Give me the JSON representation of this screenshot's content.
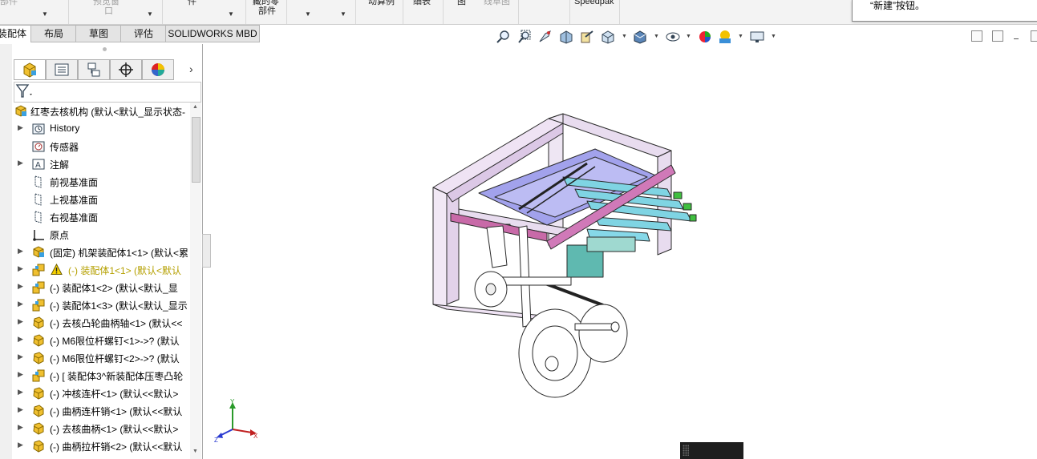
{
  "ribbon": {
    "items": [
      {
        "label": "部件",
        "gray": true
      },
      {
        "label": "预览窗",
        "gray": true
      },
      {
        "label": "口",
        "gray": true
      },
      {
        "label": "件",
        "gray": false
      },
      {
        "label": "藏的零",
        "gray": false
      },
      {
        "label": "部件",
        "gray": false
      },
      {
        "label": "动算例",
        "gray": false
      },
      {
        "label": "细表",
        "gray": false
      },
      {
        "label": "图",
        "gray": false
      },
      {
        "label": "线草图",
        "gray": true
      },
      {
        "label": "Speedpak",
        "gray": false
      }
    ],
    "tooltip_text": "“新建”按钮。"
  },
  "command_tabs": [
    {
      "label": "装配体",
      "active": true
    },
    {
      "label": "布局",
      "active": false
    },
    {
      "label": "草图",
      "active": false
    },
    {
      "label": "评估",
      "active": false
    },
    {
      "label": "SOLIDWORKS MBD",
      "active": false
    }
  ],
  "panel_tabs": [
    "featuremanager-icon",
    "propertymanager-icon",
    "configurationmanager-icon",
    "dimxpertmanager-icon",
    "displaymanager-icon"
  ],
  "tree": {
    "root": "红枣去核机构 (默认<默认_显示状态-",
    "items": [
      {
        "label": "History",
        "icon": "history-icon",
        "expander": true
      },
      {
        "label": "传感器",
        "icon": "sensors-icon",
        "expander": false
      },
      {
        "label": "注解",
        "icon": "annotations-icon",
        "expander": true
      },
      {
        "label": "前视基准面",
        "icon": "plane-icon",
        "expander": false
      },
      {
        "label": "上视基准面",
        "icon": "plane-icon",
        "expander": false
      },
      {
        "label": "右视基准面",
        "icon": "plane-icon",
        "expander": false
      },
      {
        "label": "原点",
        "icon": "origin-icon",
        "expander": false
      },
      {
        "label": "(固定) 机架装配体1<1> (默认<累",
        "icon": "assembly-icon",
        "expander": true
      },
      {
        "label": "(-) 装配体1<1> (默认<默认",
        "icon": "subassembly-warning-icon",
        "expander": true,
        "warn": true
      },
      {
        "label": "(-) 装配体1<2> (默认<默认_显",
        "icon": "subassembly-icon",
        "expander": true
      },
      {
        "label": "(-) 装配体1<3> (默认<默认_显示",
        "icon": "subassembly-icon",
        "expander": true
      },
      {
        "label": "(-) 去核凸轮曲柄轴<1> (默认<<",
        "icon": "part-icon",
        "expander": true
      },
      {
        "label": "(-) M6限位杆螺钉<1>->? (默认",
        "icon": "part-icon",
        "expander": true
      },
      {
        "label": "(-) M6限位杆螺钉<2>->? (默认",
        "icon": "part-icon",
        "expander": true
      },
      {
        "label": "(-) [ 装配体3^新装配体压枣凸轮",
        "icon": "subassembly-icon",
        "expander": true
      },
      {
        "label": "(-) 冲核连杆<1> (默认<<默认>",
        "icon": "part-icon",
        "expander": true
      },
      {
        "label": "(-) 曲柄连杆销<1> (默认<<默认",
        "icon": "part-icon",
        "expander": true
      },
      {
        "label": "(-) 去核曲柄<1> (默认<<默认>",
        "icon": "part-icon",
        "expander": true
      },
      {
        "label": "(-) 曲柄拉杆销<2> (默认<<默认",
        "icon": "part-icon",
        "expander": true
      }
    ]
  },
  "triad": {
    "x": "X",
    "y": "Y",
    "z": "Z"
  },
  "colors": {
    "frame_lavender": "#e6d6ee",
    "frame_magenta": "#d079b8",
    "rails_cyan": "#7fd4e3",
    "plates_blue": "#9a9ae8",
    "green_parts": "#3fbf3f"
  }
}
